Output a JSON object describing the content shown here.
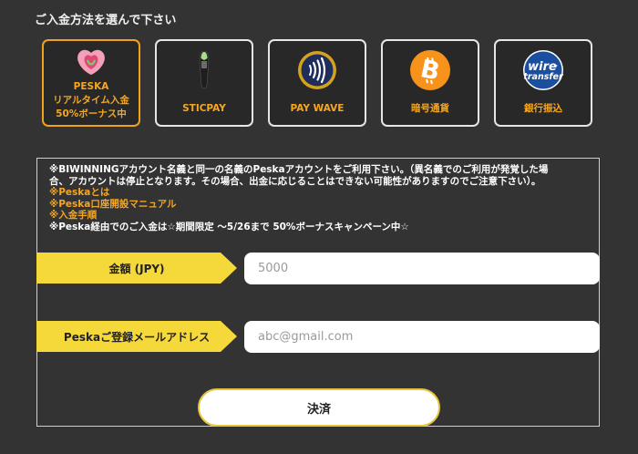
{
  "heading": "ご入金方法を選んで下さい",
  "methods": [
    {
      "id": "peska",
      "lines": [
        "PESKA",
        "リアルタイム入金",
        "50%ボーナス中"
      ],
      "selected": true,
      "icon": "peska-logo-icon"
    },
    {
      "id": "sticpay",
      "label": "STICPAY",
      "icon": "sticpay-logo-icon"
    },
    {
      "id": "paywave",
      "label": "PAY WAVE",
      "icon": "paywave-contactless-icon"
    },
    {
      "id": "crypto",
      "label": "暗号通貨",
      "icon": "bitcoin-icon"
    },
    {
      "id": "wire",
      "label": "銀行振込",
      "icon": "wire-transfer-icon",
      "icon_text": [
        "wire",
        "transfer"
      ]
    }
  ],
  "notice": {
    "line1": "※BIWINNINGアカウント名義と同一の名義のPeskaアカウントをご利用下さい。（異名義でのご利用が発覚した場",
    "line2": "合、アカウントは停止となります。その場合、出金に応じることはできない可能性がありますのでご注意下さい）。",
    "link1": "※Peskaとは",
    "link2": "※Peska口座開設マニュアル",
    "link3": "※入金手順",
    "line3": "※Peska経由でのご入金は☆期間限定 〜5/26まで 50%ボーナスキャンペーン中☆"
  },
  "form": {
    "amount_label": "金額 (JPY)",
    "amount_placeholder": "5000",
    "email_label": "Peskaご登録メールアドレス",
    "email_placeholder": "abc@gmail.com",
    "submit_label": "決済"
  },
  "colors": {
    "accent": "#f5a623",
    "label_bg": "#f5d93a",
    "bitcoin": "#f7931a",
    "wire": "#1a4fa0",
    "paywave_ring": "#d4a21d"
  }
}
